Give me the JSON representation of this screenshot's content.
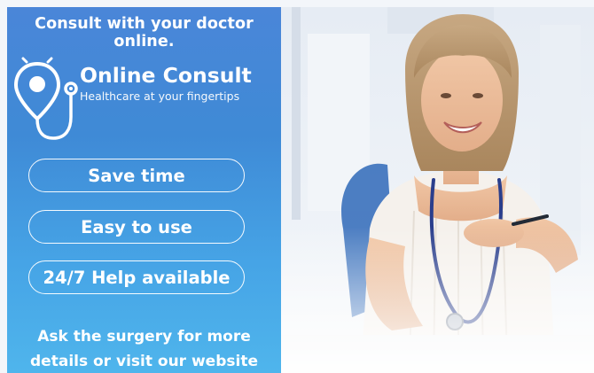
{
  "headline": "Consult with your doctor online.",
  "brand": {
    "name": "Online Consult",
    "tagline": "Healthcare at your fingertips",
    "logo_icon": "stethoscope-location-pin-icon"
  },
  "features": [
    {
      "label": "Save time"
    },
    {
      "label": "Easy to use"
    },
    {
      "label": "24/7 Help available"
    }
  ],
  "footer": {
    "line1": "Ask the surgery for more",
    "line2": "details or visit our website"
  },
  "photo": {
    "subject": "smiling female doctor with stethoscope"
  },
  "colors": {
    "panel_top": "#4a86d8",
    "panel_bottom": "#4fb5ec",
    "text": "#ffffff"
  }
}
